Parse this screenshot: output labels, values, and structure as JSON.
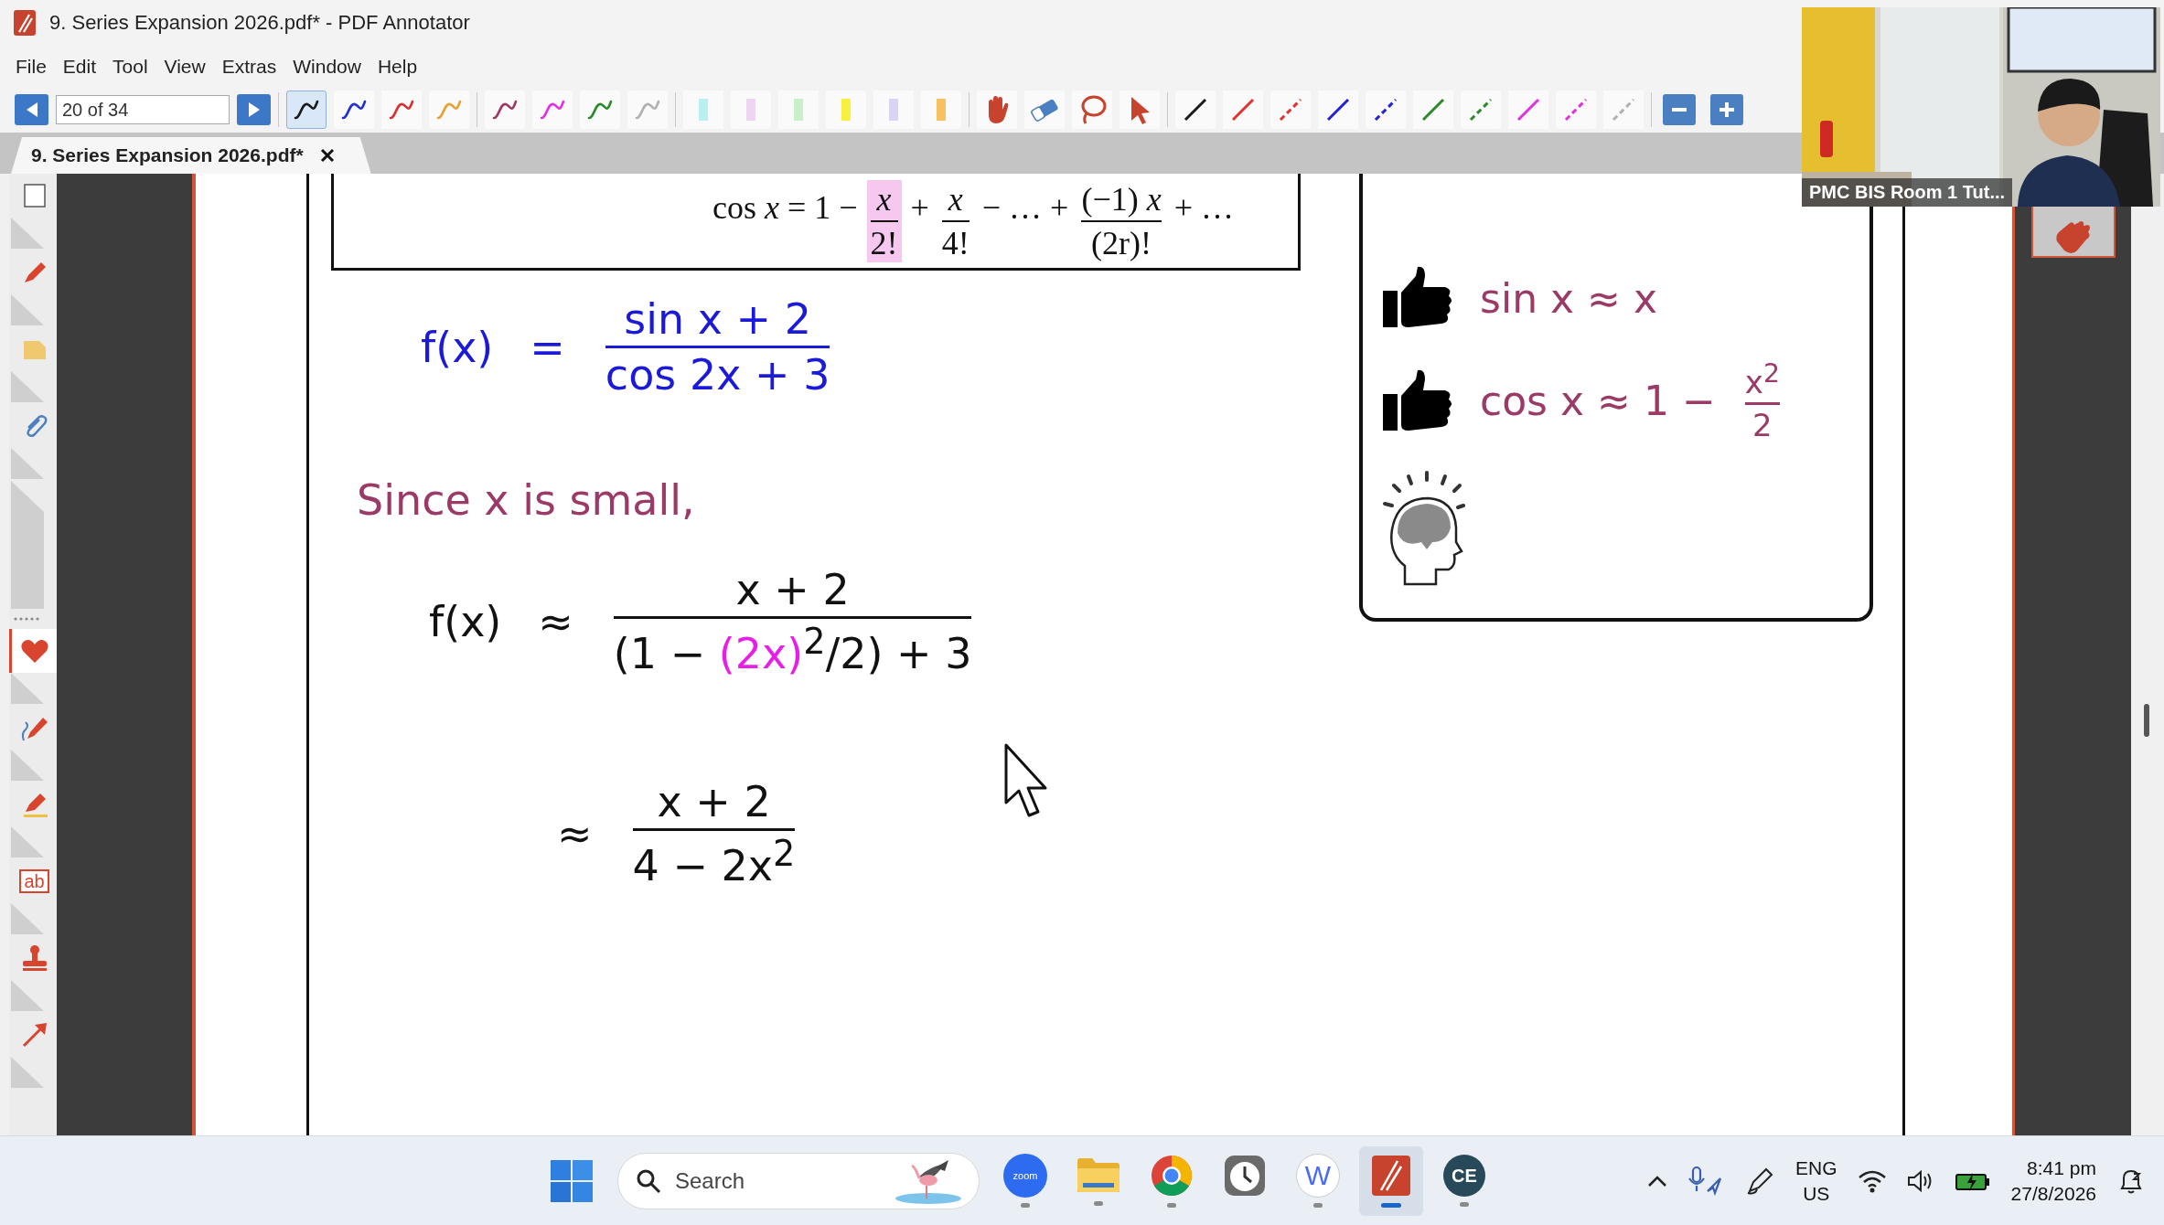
{
  "window": {
    "title": "9. Series Expansion 2026.pdf* - PDF Annotator"
  },
  "menu": [
    "File",
    "Edit",
    "Tool",
    "View",
    "Extras",
    "Window",
    "Help"
  ],
  "toolbar": {
    "page_field": "20 of 34",
    "tool_groups": [
      [
        {
          "kind": "pen",
          "color": "#1a1a1a",
          "selected": true
        },
        {
          "kind": "pen",
          "color": "#2030d0",
          "selected": false
        },
        {
          "kind": "pen",
          "color": "#d83030",
          "selected": false
        },
        {
          "kind": "pen",
          "color": "#e8a030",
          "selected": false
        }
      ],
      [
        {
          "kind": "pen",
          "color": "#9b3a66",
          "selected": false
        },
        {
          "kind": "pen",
          "color": "#e030e0",
          "selected": false
        },
        {
          "kind": "pen",
          "color": "#2a8a2a",
          "selected": false
        },
        {
          "kind": "pen",
          "color": "#b0b0b0",
          "selected": false
        }
      ],
      [
        {
          "kind": "highlighter",
          "color": "#b8f0f0",
          "selected": false
        },
        {
          "kind": "highlighter",
          "color": "#f0d4f4",
          "selected": false
        },
        {
          "kind": "highlighter",
          "color": "#c8f0c8",
          "selected": false
        },
        {
          "kind": "highlighter",
          "color": "#f8f040",
          "selected": false
        },
        {
          "kind": "highlighter",
          "color": "#d8d4f4",
          "selected": false
        },
        {
          "kind": "highlighter",
          "color": "#f8c060",
          "selected": false
        }
      ],
      [
        {
          "kind": "hand",
          "selected": false
        },
        {
          "kind": "eraser",
          "selected": false
        },
        {
          "kind": "lasso",
          "selected": false
        },
        {
          "kind": "pointer",
          "selected": false
        }
      ],
      [
        {
          "kind": "line",
          "color": "#1a1a1a",
          "selected": false
        },
        {
          "kind": "line",
          "color": "#e03030",
          "selected": false
        },
        {
          "kind": "dashed-line",
          "color": "#e03030",
          "selected": false
        },
        {
          "kind": "line",
          "color": "#2020d8",
          "selected": false
        },
        {
          "kind": "dashed-line",
          "color": "#2020d8",
          "selected": false
        },
        {
          "kind": "line",
          "color": "#2a8a2a",
          "selected": false
        },
        {
          "kind": "dashed-line",
          "color": "#2a8a2a",
          "selected": false
        },
        {
          "kind": "line",
          "color": "#e030e0",
          "selected": false
        },
        {
          "kind": "dashed-line",
          "color": "#e030e0",
          "selected": false
        },
        {
          "kind": "dashed-line",
          "color": "#b0b0b0",
          "selected": false
        }
      ],
      [
        {
          "kind": "zoom-out",
          "selected": false
        },
        {
          "kind": "zoom-in",
          "selected": false
        }
      ]
    ]
  },
  "tab": {
    "label": "9. Series Expansion 2026.pdf*",
    "selected": true
  },
  "sidebar_tools": [
    {
      "kind": "square",
      "selected": false
    },
    {
      "kind": "marker",
      "selected": false
    },
    {
      "kind": "note",
      "selected": false
    },
    {
      "kind": "clip",
      "selected": false
    },
    {
      "kind": "heart",
      "selected": true
    },
    {
      "kind": "pen",
      "selected": false
    },
    {
      "kind": "highlighter",
      "selected": false
    },
    {
      "kind": "textbox",
      "label": "ab",
      "selected": false
    },
    {
      "kind": "stamp",
      "selected": false
    },
    {
      "kind": "arrow",
      "selected": false
    }
  ],
  "document": {
    "formula": [
      {
        "kind": "text",
        "text": "cos *x* = 1 −"
      },
      {
        "kind": "fraction",
        "numerator": "*x*",
        "denominator": "2!",
        "highlighted": true
      },
      {
        "kind": "text",
        "text": "+"
      },
      {
        "kind": "fraction",
        "numerator": "*x*",
        "denominator": "4!",
        "highlighted": false
      },
      {
        "kind": "text",
        "text": "− … +"
      },
      {
        "kind": "fraction",
        "numerator": "(−1)  *x*",
        "denominator": "(2r)!",
        "highlighted": false
      },
      {
        "kind": "text",
        "text": "+ …"
      }
    ],
    "notes": [
      {
        "kind": "equation",
        "color": "#1a1ad8",
        "lhs": "f(x)",
        "op": "=",
        "numerator": "sin x + 2",
        "denominator": [
          {
            "text": "cos 2x + 3"
          }
        ]
      },
      {
        "kind": "text",
        "color": "#9b3a66",
        "text": "Since x is small,"
      },
      {
        "kind": "equation",
        "color": "#111111",
        "lhs": "f(x)",
        "op": "≈",
        "numerator": "x + 2",
        "denominator": [
          {
            "text": "(1 − "
          },
          {
            "text": "(2x)",
            "color": "#e81ee8"
          },
          {
            "text": "$^{2}$/2) + 3"
          }
        ]
      },
      {
        "kind": "equation",
        "color": "#111111",
        "op": "≈",
        "numerator": "x + 2",
        "denominator": [
          {
            "text": "4 − 2x$^{2}$"
          }
        ]
      }
    ],
    "tips": [
      {
        "kind": "thumb",
        "text": "sin x ≈ x"
      },
      {
        "kind": "thumb",
        "text": "cos x ≈ 1 −",
        "numerator": "x$^{2}$",
        "denominator": "2"
      },
      {
        "kind": "brain"
      }
    ]
  },
  "video": {
    "caption": "PMC BIS Room 1 Tut..."
  },
  "taskbar": {
    "search": {
      "placeholder": "Search"
    },
    "apps": [
      {
        "kind": "zoom",
        "label": "zoom",
        "running": true,
        "selected": false
      },
      {
        "kind": "folder",
        "running": true,
        "selected": false
      },
      {
        "kind": "browser",
        "running": true,
        "selected": false
      },
      {
        "kind": "clock",
        "running": false,
        "selected": false
      },
      {
        "kind": "letter",
        "label": "W",
        "running": true,
        "selected": false
      },
      {
        "kind": "annotator",
        "running": true,
        "selected": true
      },
      {
        "kind": "letter-dark",
        "label": "CE",
        "running": true,
        "selected": false
      }
    ],
    "tray": {
      "language": "ENG",
      "region": "US",
      "time": "8:41 pm",
      "date": "27/8/2026"
    }
  }
}
